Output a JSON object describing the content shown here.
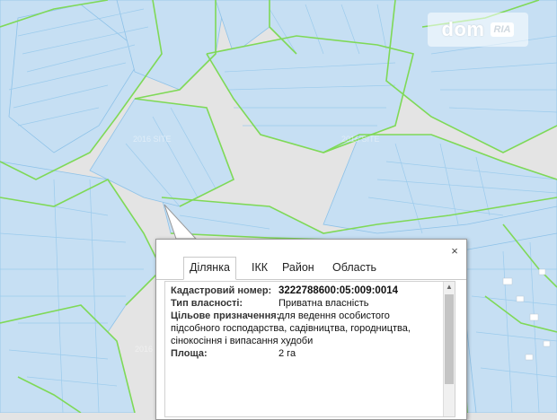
{
  "map": {
    "colors": {
      "background": "#e4e4e4",
      "parcel_fill": "#c5def2",
      "parcel_border": "#8dc0e6",
      "boundary": "#7ed957"
    },
    "watermarks": [
      "2016 SITE",
      "2016 SITE",
      "2016 SITE"
    ]
  },
  "brand": {
    "dom": "dom",
    "ria": "RIA"
  },
  "popup": {
    "close_icon": "×",
    "tabs": [
      "Ділянка",
      "ІКК",
      "Район",
      "Область"
    ],
    "active_tab": "Ділянка",
    "fields": [
      {
        "label": "Кадастровий номер:",
        "value": "3222788600:05:009:0014"
      },
      {
        "label": "Тип власності:",
        "value": "Приватна власність"
      },
      {
        "label": "Цільове призначення:",
        "value": "для ведення особистого"
      },
      {
        "label": "",
        "value": "підсобного господарства, садівництва, городництва,"
      },
      {
        "label": "",
        "value": "сінокосіння і випасання худоби"
      },
      {
        "label": "Площа:",
        "value": "2 га"
      }
    ]
  }
}
